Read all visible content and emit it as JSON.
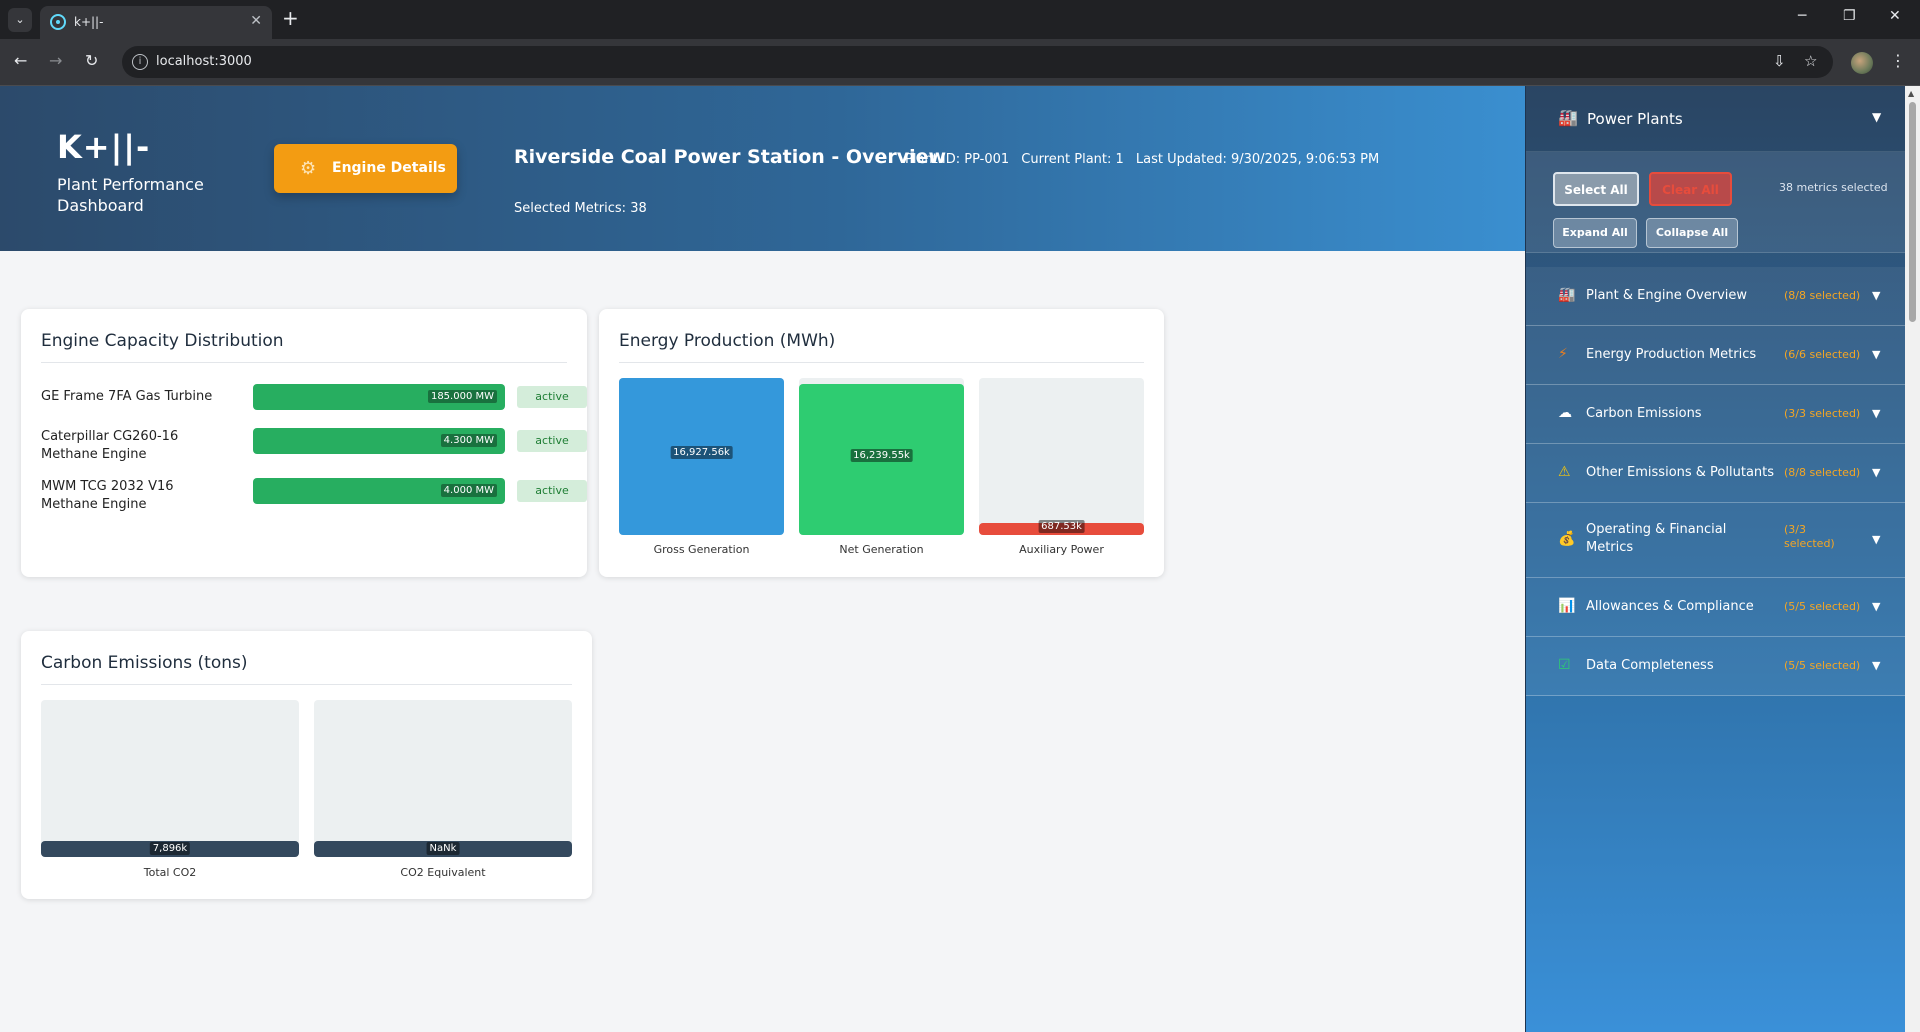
{
  "browser": {
    "tab_title": "k+||-",
    "url": "localhost:3000"
  },
  "header": {
    "logo": "K+||-",
    "subtitle": "Plant Performance Dashboard",
    "engine_button": "Engine Details",
    "plant_title": "Riverside Coal Power Station - Overview",
    "plant_id": "Plant ID: PP-001",
    "current_plant": "Current Plant: 1",
    "last_updated": "Last Updated: 9/30/2025, 9:06:53 PM",
    "selected_metrics": "Selected Metrics: 38"
  },
  "engine_capacity": {
    "title": "Engine Capacity Distribution",
    "engines": [
      {
        "name": "GE Frame 7FA Gas Turbine",
        "value": "185.000 MW",
        "status": "active"
      },
      {
        "name": "Caterpillar CG260-16 Methane Engine",
        "value": "4.300 MW",
        "status": "active"
      },
      {
        "name": "MWM TCG 2032 V16 Methane Engine",
        "value": "4.000 MW",
        "status": "active"
      }
    ]
  },
  "energy_production": {
    "title": "Energy Production (MWh)",
    "bars": [
      {
        "label": "Gross Generation",
        "value": "16,927.56k",
        "fill": 1.0,
        "color": "#3498db"
      },
      {
        "label": "Net Generation",
        "value": "16,239.55k",
        "fill": 0.96,
        "color": "#2ecc71"
      },
      {
        "label": "Auxiliary Power",
        "value": "687.53k",
        "fill": 0.04,
        "color": "#e74c3c"
      }
    ]
  },
  "carbon_emissions": {
    "title": "Carbon Emissions (tons)",
    "bars": [
      {
        "label": "Total CO2",
        "value": "7,896k",
        "fill": 0.1,
        "color": "#34495e"
      },
      {
        "label": "CO2 Equivalent",
        "value": "NaNk",
        "fill": 0.1,
        "color": "#34495e"
      }
    ]
  },
  "panel": {
    "title": "Power Plants",
    "select_all": "Select All",
    "clear_all": "Clear All",
    "expand_all": "Expand All",
    "collapse_all": "Collapse All",
    "metrics_selected": "38 metrics selected",
    "sections": [
      {
        "icon": "factory-icon",
        "name": "Plant & Engine Overview",
        "count": "(8/8 selected)"
      },
      {
        "icon": "lightning-icon",
        "name": "Energy Production Metrics",
        "count": "(6/6 selected)"
      },
      {
        "icon": "cloud-icon",
        "name": "Carbon Emissions",
        "count": "(3/3 selected)"
      },
      {
        "icon": "warning-icon",
        "name": "Other Emissions & Pollutants",
        "count": "(8/8 selected)"
      },
      {
        "icon": "money-bag-icon",
        "name": "Operating & Financial Metrics",
        "count": "(3/3 selected)"
      },
      {
        "icon": "bar-chart-icon",
        "name": "Allowances & Compliance",
        "count": "(5/5 selected)"
      },
      {
        "icon": "checkbox-icon",
        "name": "Data Completeness",
        "count": "(5/5 selected)"
      }
    ]
  }
}
